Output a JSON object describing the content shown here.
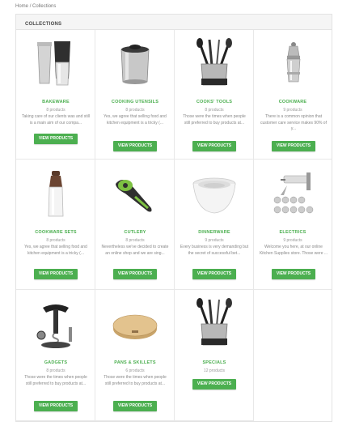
{
  "breadcrumb": {
    "home": "Home",
    "separator": "/",
    "current": "Collections"
  },
  "page": {
    "title": "COLLECTIONS"
  },
  "collections": [
    {
      "title": "BAKEWARE",
      "count": "8 products",
      "desc": "Taking care of our clients was and still is a main aim of our compa...",
      "button": "VIEW PRODUCTS",
      "icon": "cocktail-shaker-set-image"
    },
    {
      "title": "COOKING UTENSILS",
      "count": "8 products",
      "desc": "Yes, we agree that selling food and kitchen equipment is a tricky (...",
      "button": "VIEW PRODUCTS",
      "icon": "ice-bucket-image"
    },
    {
      "title": "COOKS' TOOLS",
      "count": "8 products",
      "desc": "Those were the times when people still preferred to buy products at...",
      "button": "VIEW PRODUCTS",
      "icon": "utensil-holder-image"
    },
    {
      "title": "COOKWARE",
      "count": "9 products",
      "desc": "There is a common opinion that customer care service makes 90% of y...",
      "button": "VIEW PRODUCTS",
      "icon": "cocktail-shaker-image"
    },
    {
      "title": "COOKWARE SETS",
      "count": "8 products",
      "desc": "Yes, we agree that selling food and kitchen equipment is a tricky (...",
      "button": "VIEW PRODUCTS",
      "icon": "pepper-mill-image"
    },
    {
      "title": "CUTLERY",
      "count": "8 products",
      "desc": "Nevertheless we've decided to create an online shop and we are sing...",
      "button": "VIEW PRODUCTS",
      "icon": "avocado-tool-image"
    },
    {
      "title": "DINNERWARE",
      "count": "9 products",
      "desc": "Every business is very demanding but the secret of successful bet...",
      "button": "VIEW PRODUCTS",
      "icon": "mixing-bowls-image"
    },
    {
      "title": "ELECTRICS",
      "count": "9 products",
      "desc": "Welcome you here, at our online Kitchen Supplies store. Those were ...",
      "button": "VIEW PRODUCTS",
      "icon": "cookie-press-image"
    },
    {
      "title": "GADGETS",
      "count": "8 products",
      "desc": "Those were the times when people still preferred to buy products at...",
      "button": "VIEW PRODUCTS",
      "icon": "corkscrew-set-image"
    },
    {
      "title": "PANS & SKILLETS",
      "count": "6 products",
      "desc": "Those were the times when people still preferred to buy products at...",
      "button": "VIEW PRODUCTS",
      "icon": "cutting-board-image"
    },
    {
      "title": "SPECIALS",
      "count": "12 products",
      "desc": "",
      "button": "VIEW PRODUCTS",
      "icon": "utensil-holder-image"
    }
  ],
  "colors": {
    "accent": "#4caf50",
    "border": "#e3e3e3",
    "header_bg": "#f5f5f5"
  }
}
